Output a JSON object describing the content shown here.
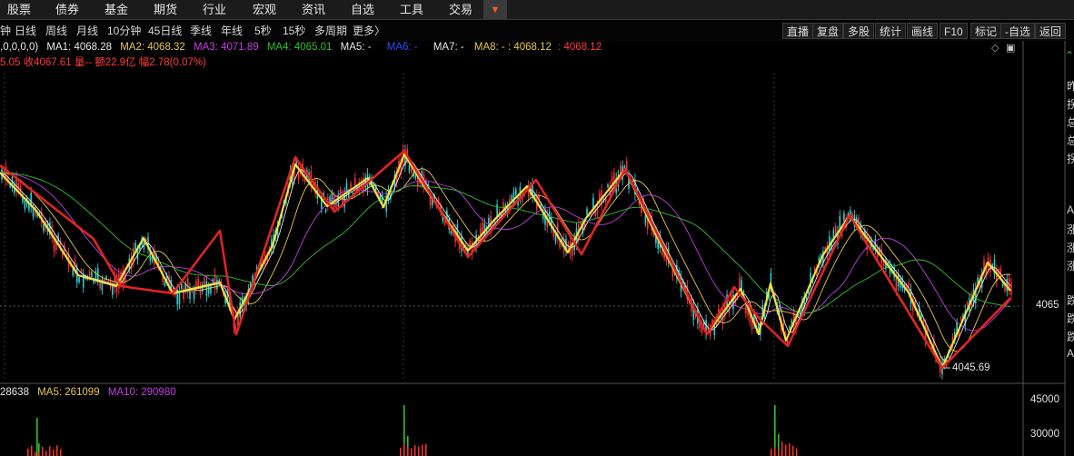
{
  "topnav": {
    "items": [
      "股票",
      "债券",
      "基金",
      "期货",
      "行业",
      "宏观",
      "资讯",
      "自选",
      "工具",
      "交易"
    ],
    "more_icon": "caret-down-icon"
  },
  "periods": [
    "钟",
    "日线",
    "周线",
    "月线",
    "10分钟",
    "45日线",
    "季线",
    "年线",
    "5秒",
    "15秒",
    "多周期",
    "更多〉"
  ],
  "tools": [
    "直播",
    "复盘",
    "多股",
    "统计",
    "画线",
    "F10",
    "标记",
    "-自选",
    "返回"
  ],
  "ma": {
    "prefix": ",0,0,0,0)",
    "items": [
      {
        "label": "MA1: 4068.28",
        "color": "#e8e8e8"
      },
      {
        "label": "MA2: 4068.32",
        "color": "#e6c84a"
      },
      {
        "label": "MA3: 4071.89",
        "color": "#c040e0"
      },
      {
        "label": "MA4: 4065.01",
        "color": "#30c030"
      },
      {
        "label": "MA5: -",
        "color": "#e8e8e8"
      },
      {
        "label": "MA6: -",
        "color": "#2a4cff"
      },
      {
        "label": "MA7: -",
        "color": "#e8e8e8"
      },
      {
        "label": "MA8: - : 4068.12",
        "color": "#e6c84a"
      },
      {
        "label": ": 4068.12",
        "color": "#ff3b3b"
      }
    ]
  },
  "info": {
    "text": "5.05 收4067.61 量-- 额22.9亿 幅2.78(0.07%)"
  },
  "price_axis": {
    "level": "4065",
    "low_label": "4045.69"
  },
  "volume": {
    "items": [
      {
        "label": "28638",
        "color": "#e8e8e8"
      },
      {
        "label": "MA5: 261099",
        "color": "#e6c84a"
      },
      {
        "label": "MA10: 290980",
        "color": "#c040e0"
      }
    ],
    "axis": [
      "45000",
      "30000"
    ]
  },
  "sidebar_glyphs": [
    "昨",
    "拐",
    "总",
    "总",
    "拐",
    "A",
    "涨",
    "涨",
    "涨",
    "跌",
    "跌",
    "跌",
    "A"
  ],
  "colors": {
    "zigzag_red": "#e02424",
    "zigzag_yellow": "#f0e040",
    "candle_up": "#ff3030",
    "candle_down": "#30d0d0"
  }
}
